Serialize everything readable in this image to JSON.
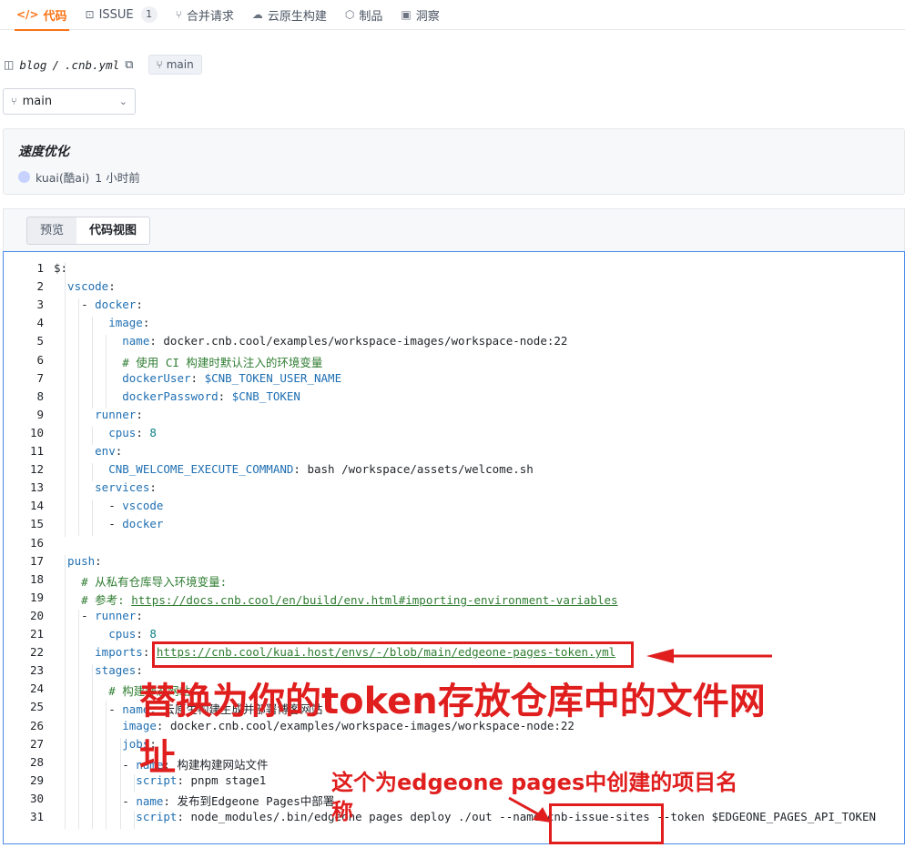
{
  "topnav": {
    "tabs": [
      {
        "icon": "</>",
        "label": "代码"
      },
      {
        "icon": "⊡",
        "label": "ISSUE",
        "count": "1"
      },
      {
        "icon": "⑂",
        "label": "合并请求"
      },
      {
        "icon": "☁",
        "label": "云原生构建"
      },
      {
        "icon": "⬡",
        "label": "制品"
      },
      {
        "icon": "▣",
        "label": "洞察"
      }
    ]
  },
  "path": {
    "repo": "blog",
    "sep": "/",
    "file": ".cnb.yml",
    "branch_tag": "main"
  },
  "branch_select": {
    "value": "main"
  },
  "commit": {
    "title": "速度优化",
    "author": "kuai(酷ai)",
    "time": "1 小时前"
  },
  "view": {
    "preview": "预览",
    "code": "代码视图"
  },
  "code": {
    "lines": [
      [
        [
          "v",
          "$:"
        ]
      ],
      [
        [
          "k",
          "  vscode"
        ],
        [
          "v",
          ":"
        ]
      ],
      [
        [
          "v",
          "    - "
        ],
        [
          "k",
          "docker"
        ],
        [
          "v",
          ":"
        ]
      ],
      [
        [
          "k",
          "        image"
        ],
        [
          "v",
          ":"
        ]
      ],
      [
        [
          "k",
          "          name"
        ],
        [
          "v",
          ": docker.cnb.cool/examples/workspace-images/workspace-node:22"
        ]
      ],
      [
        [
          "c",
          "          # 使用 CI 构建时默认注入的环境变量"
        ]
      ],
      [
        [
          "k",
          "          dockerUser"
        ],
        [
          "v",
          ": "
        ],
        [
          "k",
          "$CNB_TOKEN_USER_NAME"
        ]
      ],
      [
        [
          "k",
          "          dockerPassword"
        ],
        [
          "v",
          ": "
        ],
        [
          "k",
          "$CNB_TOKEN"
        ]
      ],
      [
        [
          "k",
          "      runner"
        ],
        [
          "v",
          ":"
        ]
      ],
      [
        [
          "k",
          "        cpus"
        ],
        [
          "v",
          ": "
        ],
        [
          "n",
          "8"
        ]
      ],
      [
        [
          "k",
          "      env"
        ],
        [
          "v",
          ":"
        ]
      ],
      [
        [
          "k",
          "        CNB_WELCOME_EXECUTE_COMMAND"
        ],
        [
          "v",
          ": bash /workspace/assets/welcome.sh"
        ]
      ],
      [
        [
          "k",
          "      services"
        ],
        [
          "v",
          ":"
        ]
      ],
      [
        [
          "v",
          "        - "
        ],
        [
          "k",
          "vscode"
        ]
      ],
      [
        [
          "v",
          "        - "
        ],
        [
          "k",
          "docker"
        ]
      ],
      [
        [
          "v",
          ""
        ]
      ],
      [
        [
          "k",
          "  push"
        ],
        [
          "v",
          ":"
        ]
      ],
      [
        [
          "c",
          "    # 从私有仓库导入环境变量:"
        ]
      ],
      [
        [
          "c",
          "    # 参考: "
        ],
        [
          "u",
          "https://docs.cnb.cool/en/build/env.html#importing-environment-variables"
        ]
      ],
      [
        [
          "v",
          "    - "
        ],
        [
          "k",
          "runner"
        ],
        [
          "v",
          ":"
        ]
      ],
      [
        [
          "k",
          "        cpus"
        ],
        [
          "v",
          ": "
        ],
        [
          "n",
          "8"
        ]
      ],
      [
        [
          "k",
          "      imports"
        ],
        [
          "v",
          ": "
        ],
        [
          "u",
          "https://cnb.cool/kuai.host/envs/-/blob/main/edgeone-pages-token.yml"
        ]
      ],
      [
        [
          "k",
          "      stages"
        ],
        [
          "v",
          ":"
        ]
      ],
      [
        [
          "c",
          "        # 构建静态网站"
        ]
      ],
      [
        [
          "v",
          "        - "
        ],
        [
          "k",
          "name"
        ],
        [
          "v",
          ": 云原生构建生成并部署博客网站"
        ]
      ],
      [
        [
          "k",
          "          image"
        ],
        [
          "v",
          ": docker.cnb.cool/examples/workspace-images/workspace-node:22"
        ]
      ],
      [
        [
          "k",
          "          jobs"
        ],
        [
          "v",
          ":"
        ]
      ],
      [
        [
          "v",
          "          - "
        ],
        [
          "k",
          "name"
        ],
        [
          "v",
          ": 构建构建网站文件"
        ]
      ],
      [
        [
          "k",
          "            script"
        ],
        [
          "v",
          ": pnpm stage1"
        ]
      ],
      [
        [
          "v",
          "          - "
        ],
        [
          "k",
          "name"
        ],
        [
          "v",
          ": 发布到Edgeone Pages中部署"
        ]
      ],
      [
        [
          "k",
          "            script"
        ],
        [
          "v",
          ": node_modules/.bin/edgeone pages deploy ./out --name cnb-issue-sites --token $EDGEONE_PAGES_API_TOKEN"
        ]
      ]
    ]
  },
  "annotations": {
    "big_line1": "替换为你的token存放仓库中的文件网",
    "big_line2": "址",
    "small_line1": "这个为edgeone pages中创建的项目名",
    "small_line2": "称",
    "color": "#e01e1e"
  }
}
